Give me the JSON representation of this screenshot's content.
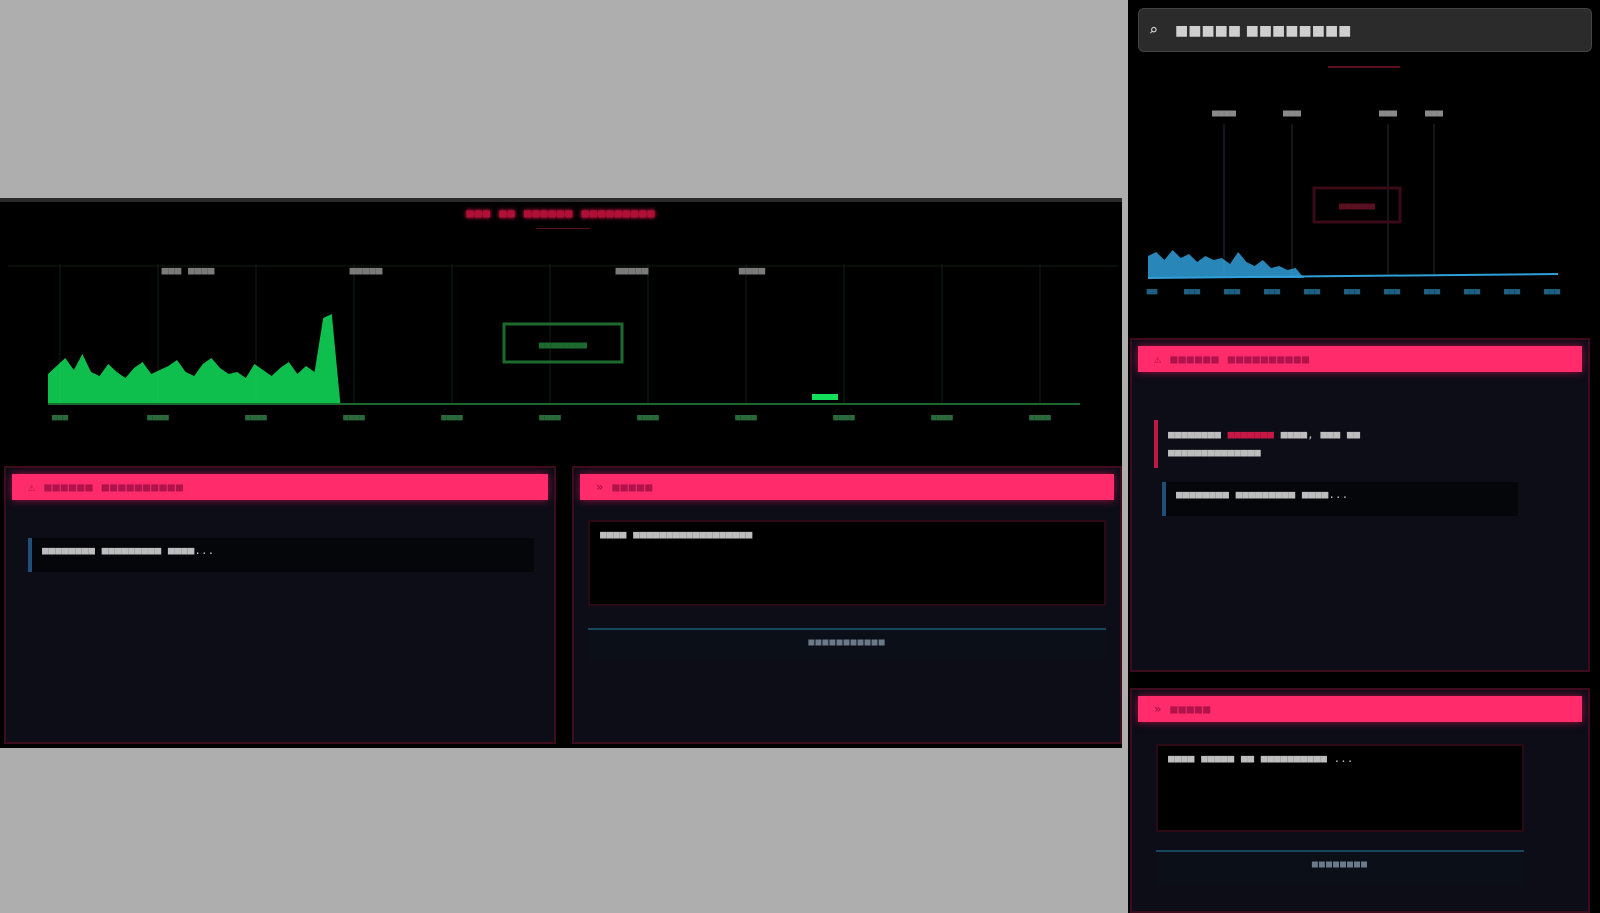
{
  "main": {
    "title": "■■■ ■■ ■■■■■■ ■■■■■■■■■",
    "chart": {
      "top_labels": [
        "■■■ ■■■■",
        "■■■■■",
        "■■■■■",
        "■■■■"
      ],
      "center_label": "■■■■■■■■",
      "x_ticks": [
        "■■■",
        "■■■■",
        "■■■■",
        "■■■■",
        "■■■■",
        "■■■■",
        "■■■■",
        "■■■■",
        "■■■■",
        "■■■■",
        "■■■■"
      ],
      "line_color": "#12e05a"
    }
  },
  "panels": {
    "left": {
      "header": "■■■■■■ ■■■■■■■■■■",
      "message": "■■■■■■■■ ■■■■■■■■■ ■■■■..."
    },
    "center": {
      "header": "■■■■■",
      "input_text": "■■■■ ■■■■■■■■■■■■■■■■■■",
      "send_label": "■■■■■■■■■■■"
    }
  },
  "sidebar": {
    "search": {
      "value": "■■■■■ ■■■■■■■■",
      "icon": "search-icon"
    },
    "chart": {
      "top_labels": [
        "■■■■",
        "■■■",
        "■■■",
        "■■■"
      ],
      "center_label": "■■■■■■",
      "x_ticks": [
        "■■",
        "■■■",
        "■■■",
        "■■■",
        "■■■",
        "■■■",
        "■■■",
        "■■■",
        "■■■",
        "■■■",
        "■■■"
      ],
      "line_color": "#2f9fd8"
    },
    "alerts_panel": {
      "header": "■■■■■■ ■■■■■■■■■■",
      "alert_prefix": "■■■■■■■■",
      "alert_highlight": "■■■■■■■",
      "alert_rest": "■■■■, ■■■ ■■",
      "alert_line2": "■■■■■■■■■■■■■■",
      "message": "■■■■■■■■ ■■■■■■■■■ ■■■■..."
    },
    "input_panel": {
      "header": "■■■■■",
      "input_text": "■■■■ ■■■■■ ■■ ■■■■■■■■■■ ...",
      "send_label": "■■■■■■■■"
    }
  },
  "colors": {
    "accent": "#ff2b6b",
    "panel_bg": "#0c0d17",
    "chart_green": "#12e05a",
    "chart_blue": "#2f9fd8"
  }
}
